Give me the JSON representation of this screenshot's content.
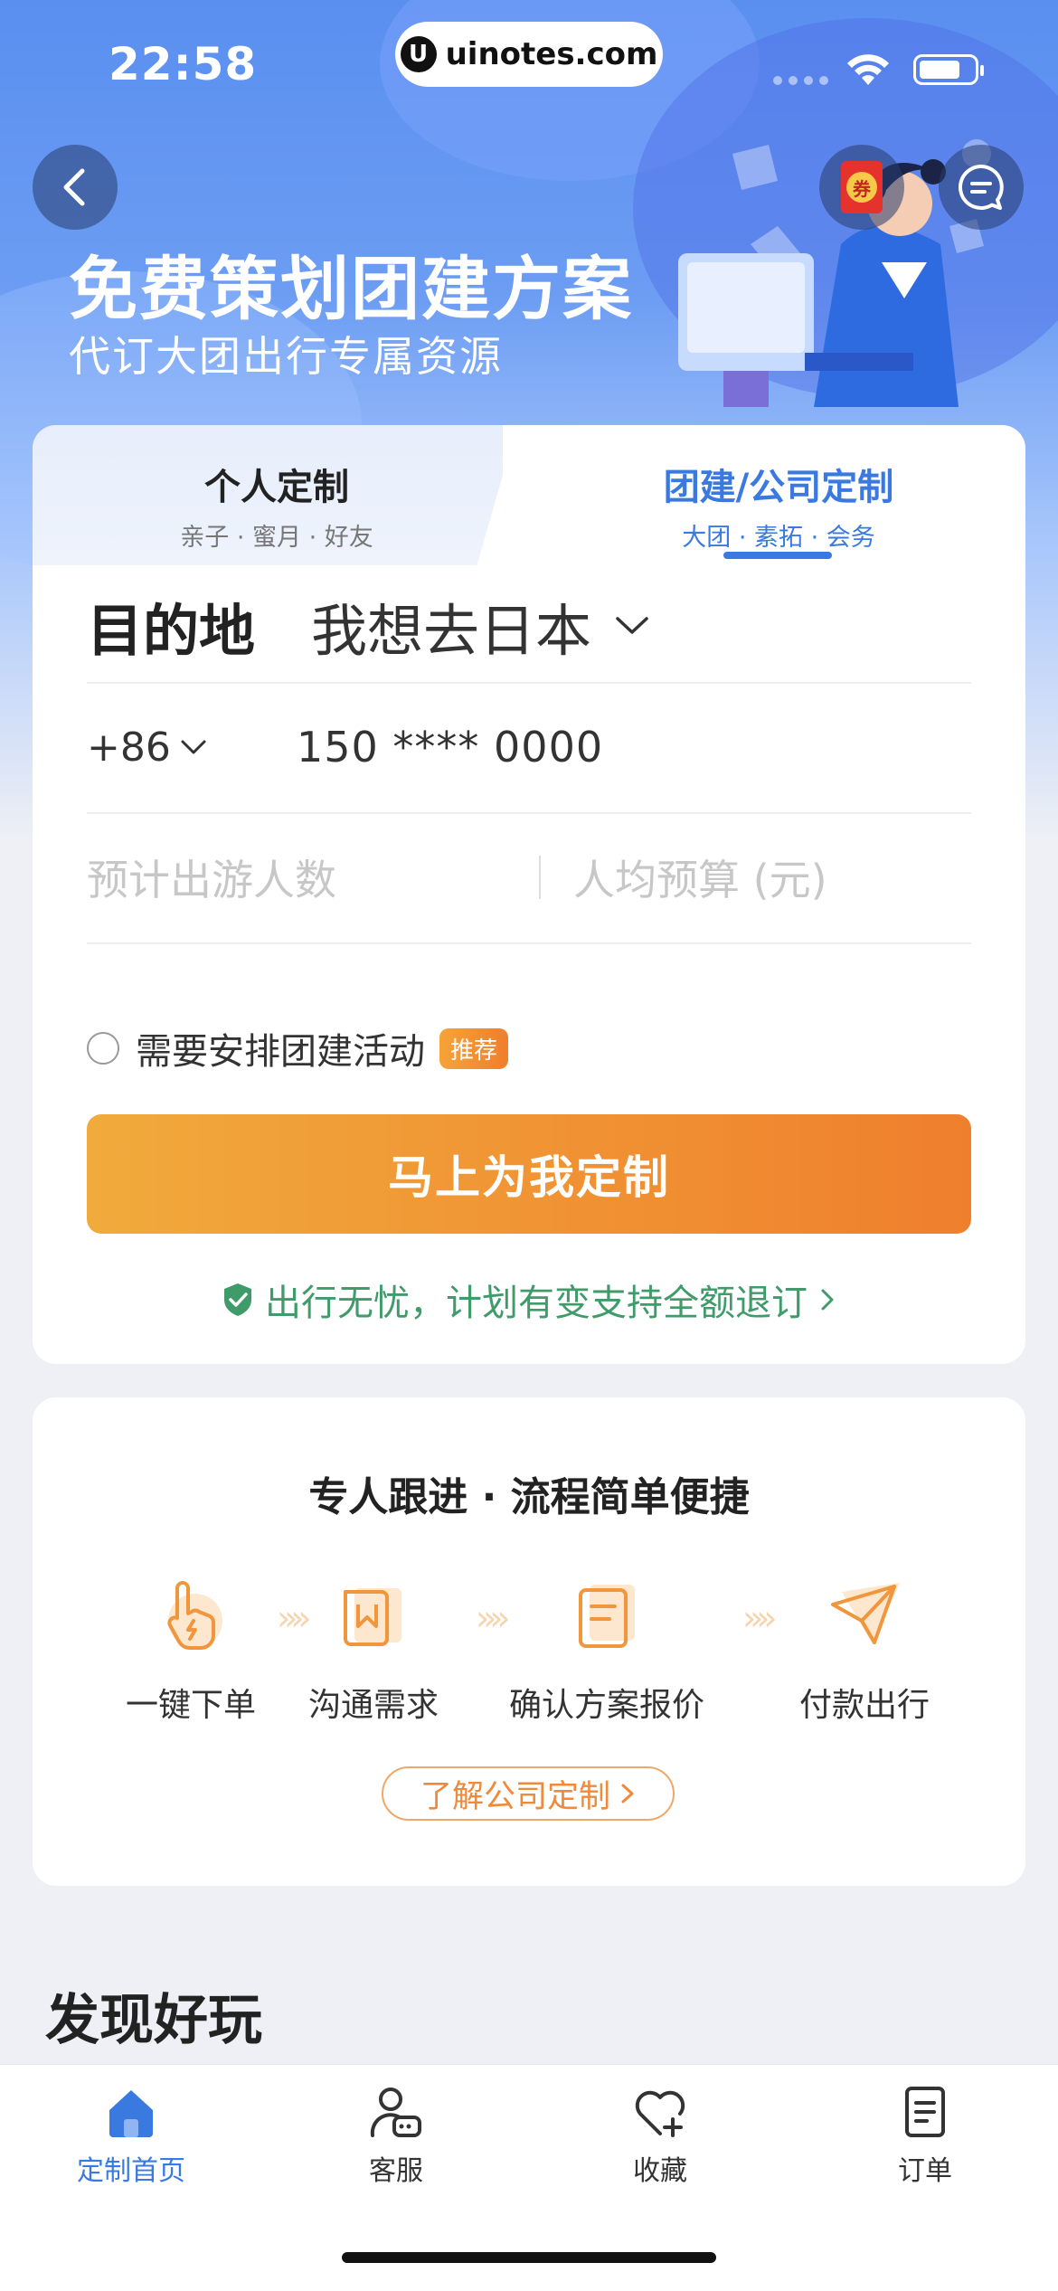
{
  "status_bar": {
    "time": "22:58",
    "url": "uinotes.com"
  },
  "hero": {
    "title": "免费策划团建方案",
    "subtitle": "代订大团出行专属资源"
  },
  "coupon": {
    "label": "券"
  },
  "tabs": [
    {
      "title": "个人定制",
      "subtitle": "亲子 · 蜜月 · 好友",
      "active": false
    },
    {
      "title": "团建/公司定制",
      "subtitle": "大团 · 素拓 · 会务",
      "active": true
    }
  ],
  "form": {
    "destination_label": "目的地",
    "destination_value": "我想去日本",
    "phone_code": "+86",
    "phone_number": "150 **** 0000",
    "people_placeholder": "预计出游人数",
    "budget_placeholder": "人均预算 (元)",
    "activity_checkbox_label": "需要安排团建活动",
    "activity_tag": "推荐",
    "submit_label": "马上为我定制",
    "guarantee_text": "出行无忧，计划有变支持全额退订"
  },
  "process": {
    "title": "专人跟进 · 流程简单便捷",
    "steps": [
      {
        "label": "一键下单",
        "icon": "tap-icon"
      },
      {
        "label": "沟通需求",
        "icon": "chat-doc-icon"
      },
      {
        "label": "确认方案报价",
        "icon": "document-icon"
      },
      {
        "label": "付款出行",
        "icon": "paper-plane-icon"
      }
    ],
    "learn_more_label": "了解公司定制"
  },
  "discover_title": "发现好玩",
  "tabbar": [
    {
      "label": "定制首页",
      "icon": "home-icon",
      "active": true
    },
    {
      "label": "客服",
      "icon": "customer-service-icon",
      "active": false
    },
    {
      "label": "收藏",
      "icon": "heart-plus-icon",
      "active": false
    },
    {
      "label": "订单",
      "icon": "order-list-icon",
      "active": false
    }
  ],
  "colors": {
    "accent_blue": "#3a7ae0",
    "cta_orange": "#ef7f2d",
    "guarantee_green": "#3f9b6a"
  }
}
